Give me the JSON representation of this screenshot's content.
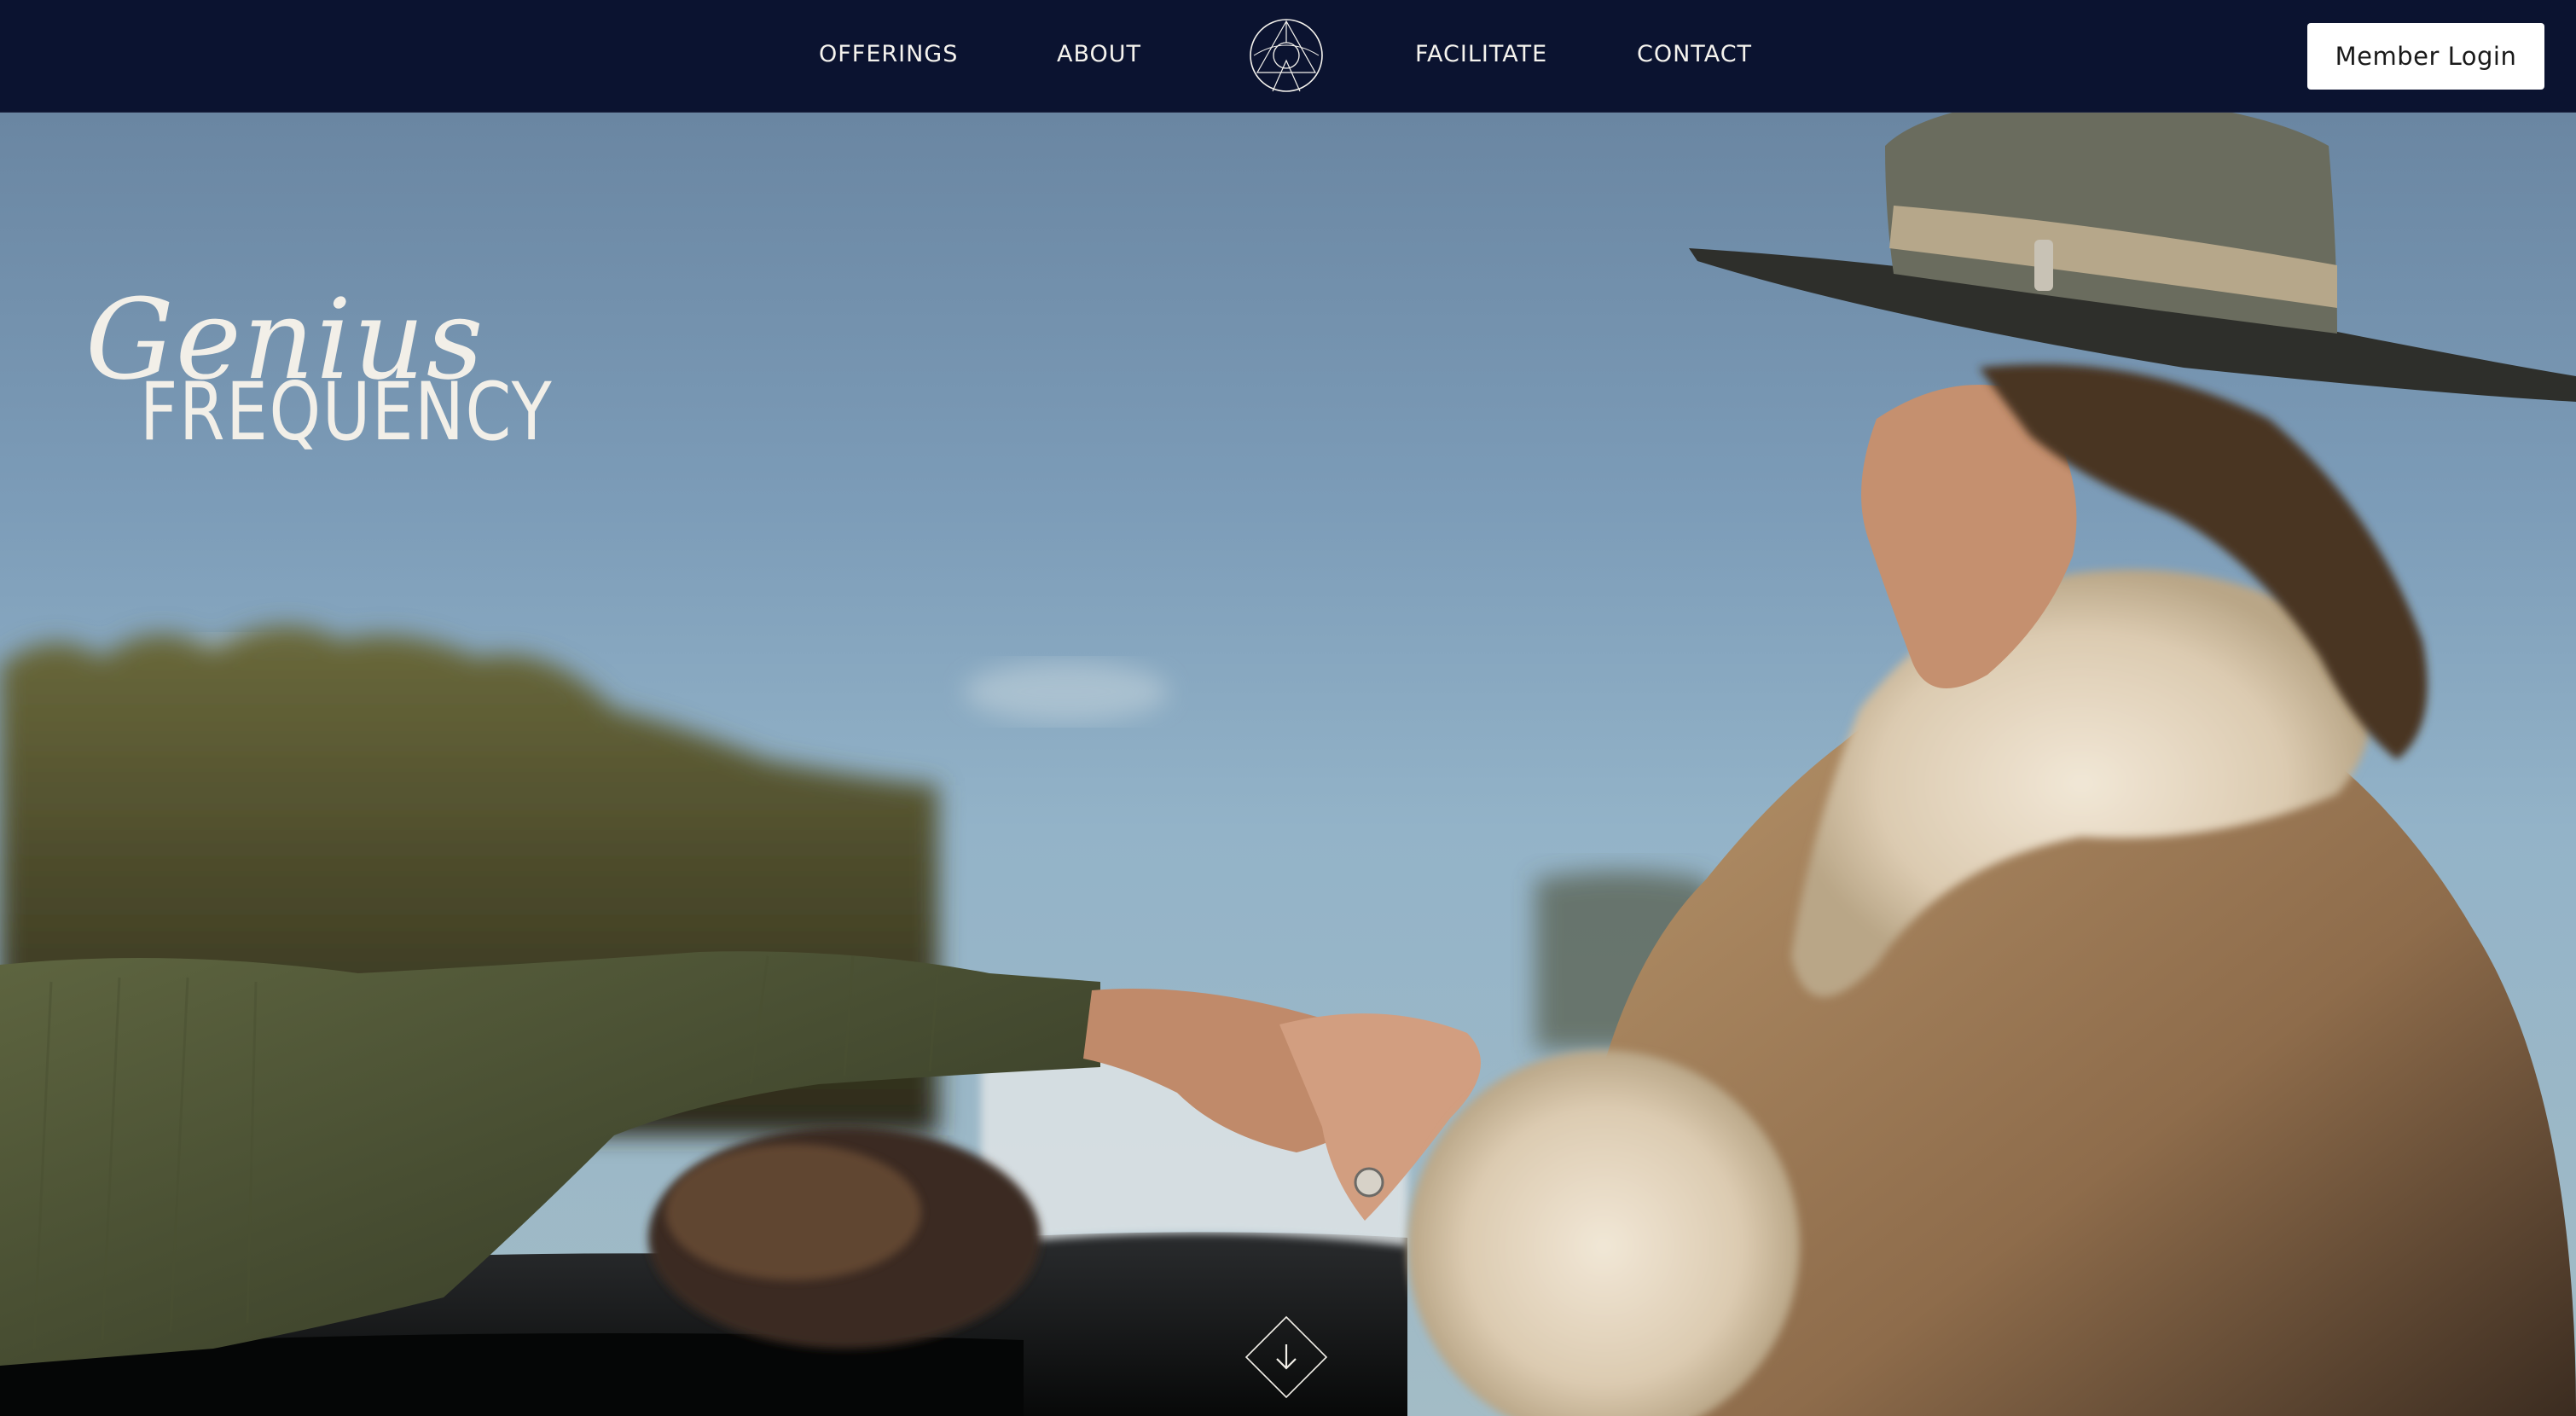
{
  "nav": {
    "links": [
      {
        "id": "offerings",
        "label": "OFFERINGS"
      },
      {
        "id": "about",
        "label": "ABOUT"
      },
      {
        "id": "facilitate",
        "label": "FACILITATE"
      },
      {
        "id": "contact",
        "label": "CONTACT"
      }
    ],
    "logo_icon": "sacred-geometry-logo-icon",
    "login_label": "Member Login"
  },
  "hero": {
    "brand_script": "Genius",
    "brand_caps": "FREQUENCY",
    "scroll_icon": "arrow-down-diamond-icon"
  },
  "colors": {
    "nav_background": "#0b1330",
    "nav_text": "#f5f3ee",
    "login_background": "#ffffff",
    "login_text": "#1a1a1a",
    "brand_text": "#f2efe8"
  }
}
